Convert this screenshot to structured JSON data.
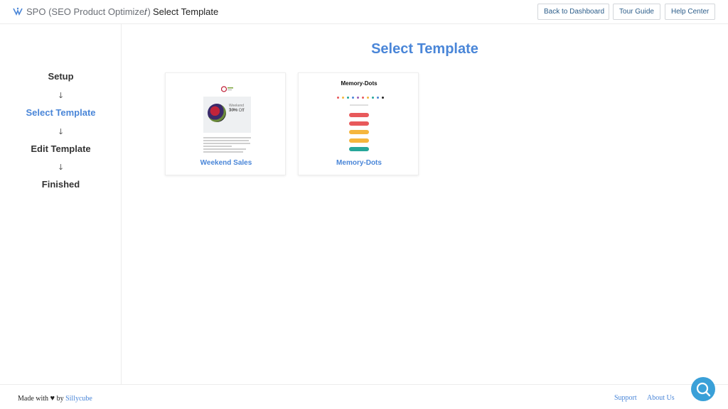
{
  "header": {
    "app_name": "SPO (SEO Product Optimizer)",
    "separator": "/",
    "current_page": "Select Template",
    "buttons": {
      "back_to_dashboard": "Back to Dashboard",
      "tour_guide": "Tour Guide",
      "help_center": "Help Center"
    }
  },
  "sidebar": {
    "steps": [
      {
        "label": "Setup",
        "active": false
      },
      {
        "label": "Select Template",
        "active": true
      },
      {
        "label": "Edit Template",
        "active": false
      },
      {
        "label": "Finished",
        "active": false
      }
    ],
    "arrow_glyph": "🡓"
  },
  "main": {
    "title": "Select Template",
    "templates": [
      {
        "label": "Weekend Sales",
        "thumb": {
          "hero_line1": "Weekend Sales",
          "hero_line2": "30% Off"
        }
      },
      {
        "label": "Memory-Dots",
        "thumb": {
          "title": "Memory-Dots"
        }
      }
    ]
  },
  "footer": {
    "made_with": "Made with",
    "by": "by",
    "brand": "Sillycube",
    "heart_glyph": "♥",
    "links": {
      "support": "Support",
      "about": "About Us"
    }
  },
  "colors": {
    "accent": "#4a86d8",
    "fab": "#3aa0d8",
    "pill_colors": [
      "#e8595b",
      "#e8595b",
      "#f5b63d",
      "#f5b63d",
      "#26a69a"
    ],
    "dot_colors": [
      "#e8595b",
      "#f5b63d",
      "#26a69a",
      "#4a86d8",
      "#9c5fb5",
      "#e8595b",
      "#f5b63d",
      "#26a69a",
      "#4a86d8",
      "#222222"
    ]
  },
  "icons": {
    "logo": "spo-logo-icon",
    "help_fab": "search-help-icon"
  }
}
